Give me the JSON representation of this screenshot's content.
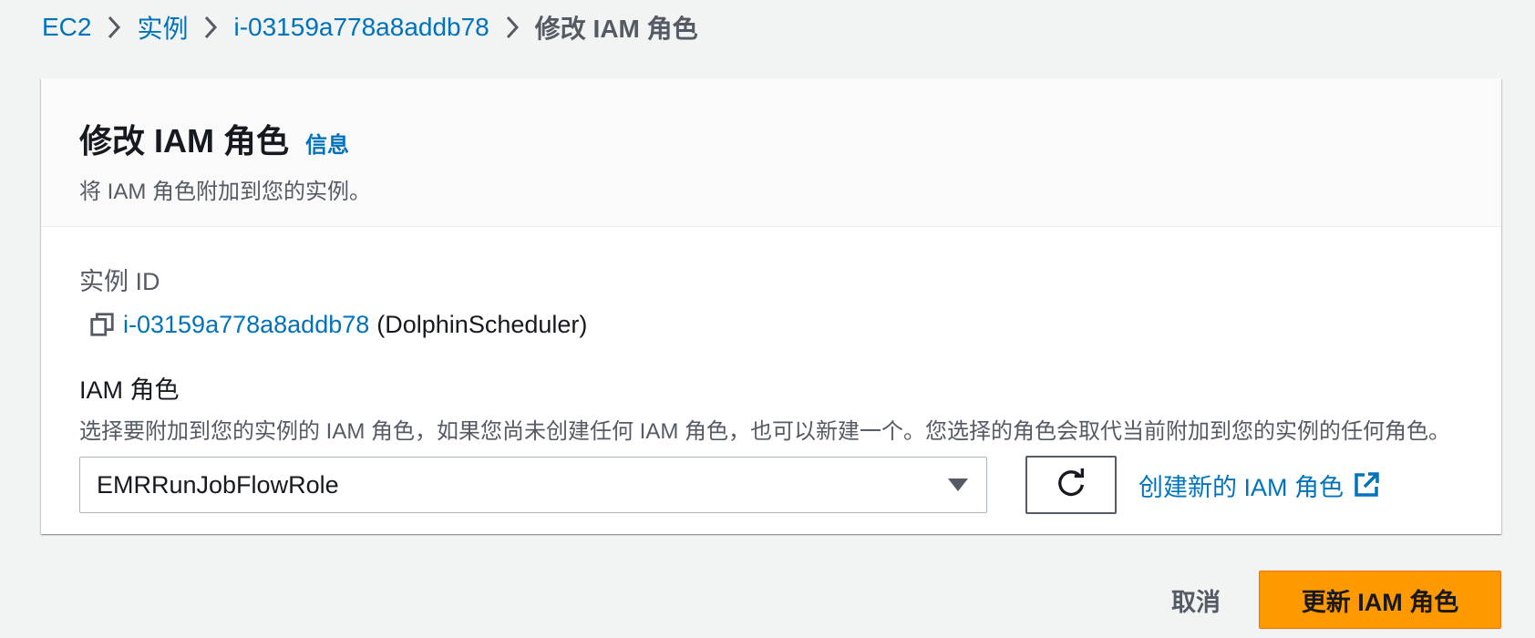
{
  "breadcrumb": {
    "items": [
      {
        "label": "EC2"
      },
      {
        "label": "实例"
      },
      {
        "label": "i-03159a778a8addb78"
      }
    ],
    "current": "修改 IAM 角色"
  },
  "header": {
    "title": "修改 IAM 角色",
    "info_link": "信息",
    "description": "将 IAM 角色附加到您的实例。"
  },
  "instance": {
    "label": "实例 ID",
    "id": "i-03159a778a8addb78",
    "name": "(DolphinScheduler)"
  },
  "role": {
    "label": "IAM 角色",
    "description": "选择要附加到您的实例的 IAM 角色，如果您尚未创建任何 IAM 角色，也可以新建一个。您选择的角色会取代当前附加到您的实例的任何角色。",
    "selected": "EMRRunJobFlowRole",
    "create_link": "创建新的 IAM 角色"
  },
  "footer": {
    "cancel_label": "取消",
    "submit_label": "更新 IAM 角色"
  },
  "colors": {
    "link": "#0073bb",
    "primary": "#ff9900",
    "text": "#16191f",
    "secondary_text": "#545b64",
    "background": "#f2f3f3"
  },
  "icons": {
    "separator": "chevron-right-icon",
    "copy": "copy-icon",
    "dropdown": "caret-down-icon",
    "refresh": "refresh-icon",
    "external": "external-link-icon"
  }
}
